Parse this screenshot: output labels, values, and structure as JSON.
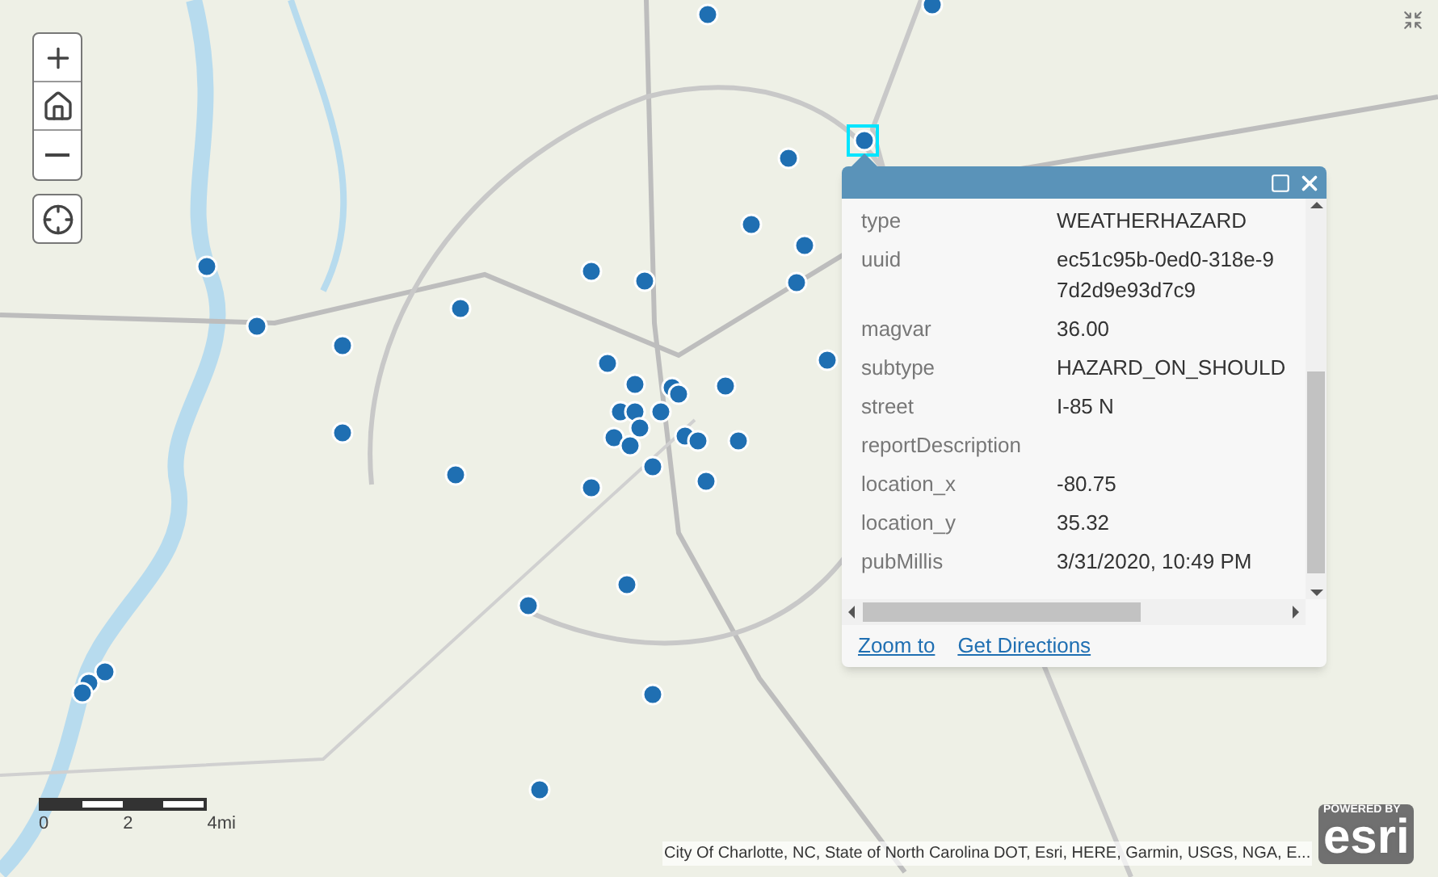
{
  "popup": {
    "fields": [
      {
        "label": "type",
        "value_lines": [
          "WEATHERHAZARD"
        ]
      },
      {
        "label": "uuid",
        "value_lines": [
          "ec51c95b-0ed0-318e-9",
          "7d2d9e93d7c9"
        ]
      },
      {
        "label": "magvar",
        "value_lines": [
          "36.00"
        ]
      },
      {
        "label": "subtype",
        "value_lines": [
          "HAZARD_ON_SHOULD"
        ]
      },
      {
        "label": "street",
        "value_lines": [
          "I-85 N"
        ]
      },
      {
        "label": "reportDescription"
      },
      {
        "label": "location_x",
        "value_lines": [
          "-80.75"
        ]
      },
      {
        "label": "location_y",
        "value_lines": [
          "35.32"
        ]
      },
      {
        "label": "pubMillis",
        "value_lines": [
          "3/31/2020, 10:49 PM"
        ]
      }
    ],
    "links": [
      "Zoom to",
      "Get Directions"
    ]
  },
  "scale_bar": {
    "labels": [
      "0",
      "2",
      "4mi"
    ]
  },
  "attribution": "City Of Charlotte, NC, State of North Carolina DOT, Esri, HERE, Garmin, USGS, NGA, E...",
  "logo": {
    "tagline": "POWERED BY",
    "name": "esri"
  }
}
